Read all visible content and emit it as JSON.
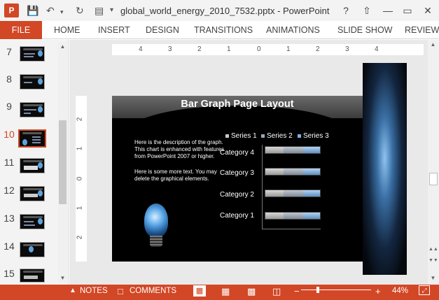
{
  "window": {
    "title": "global_world_energy_2010_7532.pptx - PowerPoint",
    "app_logo": "P",
    "help": "?",
    "minimize": "—",
    "restore": "▭",
    "close": "✕"
  },
  "quick_access": {
    "save_icon": "save-icon",
    "undo_icon": "undo-icon",
    "redo_icon": "redo-icon",
    "start_icon": "start-from-beginning-icon"
  },
  "ribbon": {
    "file_label": "FILE",
    "tabs": [
      "HOME",
      "INSERT",
      "DESIGN",
      "TRANSITIONS",
      "ANIMATIONS",
      "SLIDE SHOW",
      "REVIEW"
    ]
  },
  "thumbnails": [
    {
      "number": "7"
    },
    {
      "number": "8"
    },
    {
      "number": "9"
    },
    {
      "number": "10",
      "selected": true
    },
    {
      "number": "11"
    },
    {
      "number": "12"
    },
    {
      "number": "13"
    },
    {
      "number": "14"
    },
    {
      "number": "15"
    }
  ],
  "ruler": {
    "h_labels": [
      "4",
      "3",
      "2",
      "1",
      "0",
      "1",
      "2",
      "3",
      "4"
    ],
    "v_labels": [
      "2",
      "1",
      "0",
      "1",
      "2"
    ]
  },
  "slide": {
    "title": "Bar Graph Page Layout",
    "desc1": "Here is the description of the graph.  This chart is enhanced with features from PowerPoint 2007 or higher.",
    "desc2": "Here is some more text. You may delete the graphical elements.",
    "chart_data": {
      "type": "bar",
      "orientation": "horizontal",
      "categories": [
        "Category 1",
        "Category 2",
        "Category 3",
        "Category 4"
      ],
      "series": [
        {
          "name": "Series 1",
          "color": "#c8c8c8"
        },
        {
          "name": "Series 2",
          "color": "#9aa6b4"
        },
        {
          "name": "Series 3",
          "color": "#7fb0e0"
        }
      ],
      "legend_position": "top"
    }
  },
  "statusbar": {
    "notes": "NOTES",
    "comments": "COMMENTS",
    "zoom": "44%",
    "zoom_minus": "−",
    "zoom_plus": "+"
  }
}
